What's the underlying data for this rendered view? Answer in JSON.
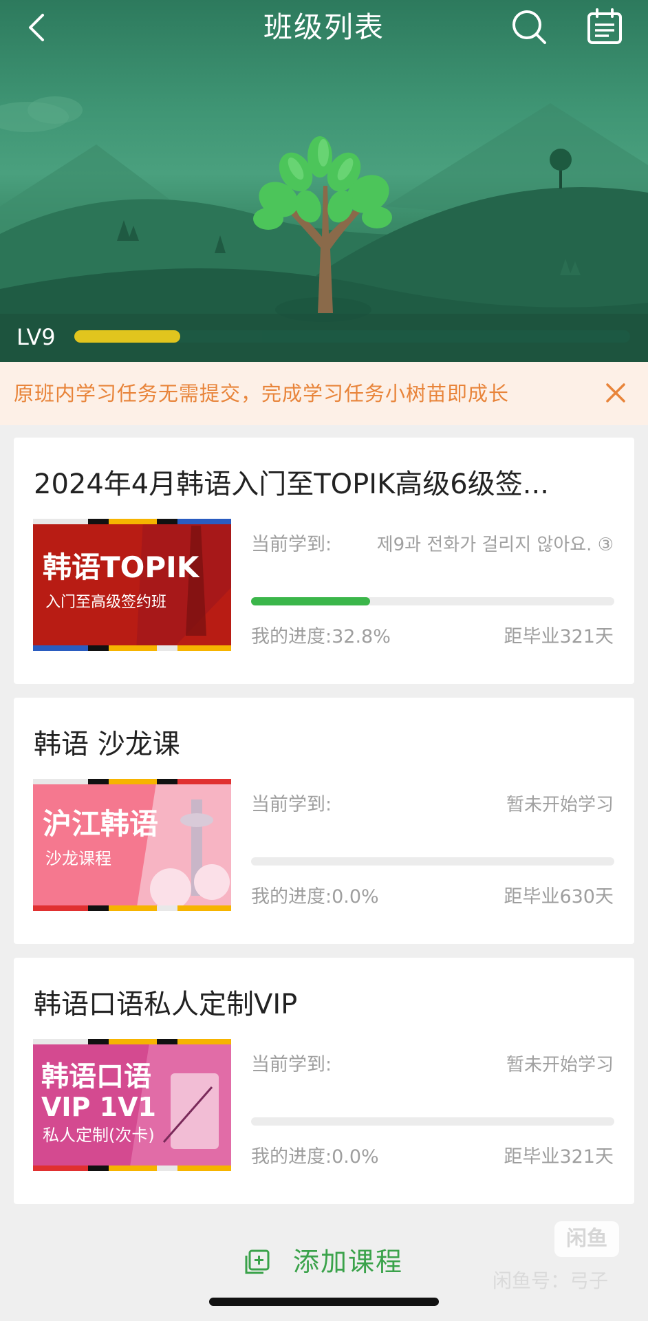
{
  "header": {
    "title": "班级列表",
    "back_icon": "chevron-left-icon",
    "search_icon": "search-icon",
    "calendar_icon": "calendar-icon"
  },
  "level": {
    "label": "LV9",
    "progress_fraction": 0.19,
    "fill_color": "#f7d21b"
  },
  "notice": {
    "text": "原班内学习任务无需提交，完成学习任务小树苗即成长",
    "close_icon": "close-icon",
    "color": "#e8843a"
  },
  "courses": [
    {
      "title": "2024年4月韩语入门至TOPIK高级6级签...",
      "thumb": {
        "line1": "韩语TOPIK",
        "line2": "入门至高级签约班"
      },
      "current_label": "当前学到:",
      "current_value": "제9과 전화가 걸리지 않아요. ③",
      "progress_fraction": 0.328,
      "progress_text": "我的进度:32.8%",
      "graduation_text": "距毕业321天"
    },
    {
      "title": "韩语 沙龙课",
      "thumb": {
        "line1": "沪江韩语",
        "line2": "沙龙课程"
      },
      "current_label": "当前学到:",
      "current_value": "暂未开始学习",
      "progress_fraction": 0.0,
      "progress_text": "我的进度:0.0%",
      "graduation_text": "距毕业630天"
    },
    {
      "title": "韩语口语私人定制VIP",
      "thumb": {
        "line1": "韩语口语",
        "line2": "VIP 1V1",
        "line3": "私人定制(次卡)"
      },
      "current_label": "当前学到:",
      "current_value": "暂未开始学习",
      "progress_fraction": 0.0,
      "progress_text": "我的进度:0.0%",
      "graduation_text": "距毕业321天"
    }
  ],
  "footer": {
    "add_course_label": "添加课程",
    "add_icon": "add-square-icon",
    "watermark_badge": "闲鱼",
    "watermark_text": "闲鱼号：弓子",
    "accent_color": "#3aa24a"
  }
}
